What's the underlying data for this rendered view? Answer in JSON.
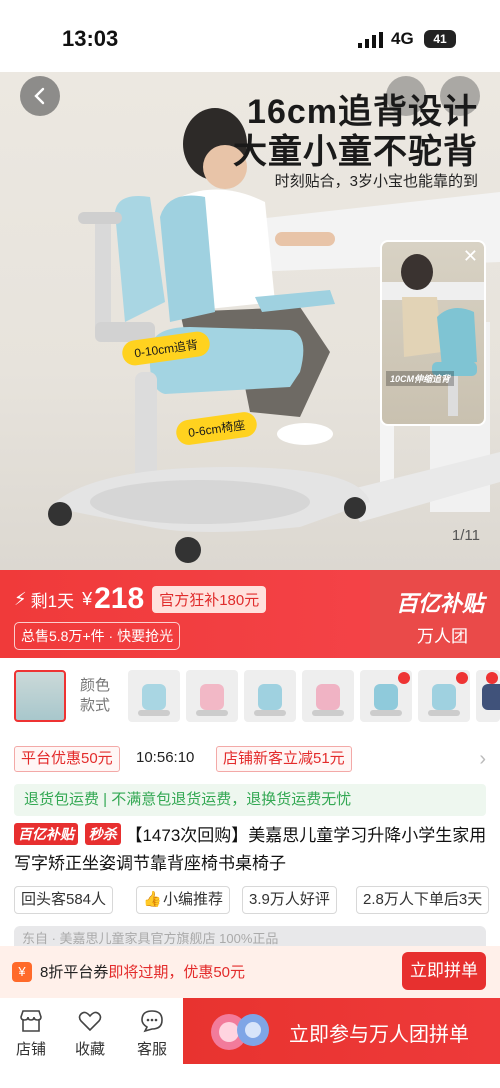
{
  "status": {
    "time": "13:03",
    "network": "4G",
    "battery": "41"
  },
  "hero": {
    "title_line1": "16cm追背设计",
    "title_line2": "大童小童不驼背",
    "subtitle": "时刻贴合，3岁小宝也能靠的到",
    "tag_back": "0-10cm追背",
    "tag_seat": "0-6cm椅座",
    "video_caption": "10CM伸缩追背",
    "page_indicator": "1/11"
  },
  "price_band": {
    "remaining": "剩1天",
    "currency": "¥",
    "price": "218",
    "subsidy": "官方狂补180元",
    "sales": "总售5.8万+件 · 快要抢光",
    "brand": "百亿补贴",
    "group": "万人团"
  },
  "style": {
    "label": "颜色款式"
  },
  "coupons": [
    {
      "text": "平台优惠50元"
    },
    {
      "text": "10:56:10"
    },
    {
      "text": "店铺新客立减51元"
    }
  ],
  "service": "退货包运费 | 不满意包退货运费，退换货运费无忧",
  "product": {
    "tag_brand": "百亿补贴",
    "tag_flash": "秒杀",
    "title": "【1473次回购】美嘉思儿童学习升降小学生家用写字矫正坐姿调节靠背座椅书桌椅子"
  },
  "stats": [
    {
      "text": "回头客584人"
    },
    {
      "text": "小编推荐"
    },
    {
      "text": "3.9万人好评"
    },
    {
      "text": "2.8万人下单后3天"
    }
  ],
  "store_strip": "东自  ·  美嘉思儿童家具官方旗舰店  100%正品",
  "promo": {
    "text_prefix": "8折平台券",
    "text_highlight": "即将过期，优惠50元",
    "button": "立即拼单"
  },
  "bottom_nav": [
    {
      "label": "店铺",
      "icon": "store-icon"
    },
    {
      "label": "收藏",
      "icon": "heart-icon"
    },
    {
      "label": "客服",
      "icon": "chat-icon"
    }
  ],
  "cta": {
    "label": "立即参与万人团拼单"
  },
  "colors": {
    "accent": "#e7302f",
    "service_green": "#33a853",
    "tag_yellow": "#ffd21f"
  }
}
